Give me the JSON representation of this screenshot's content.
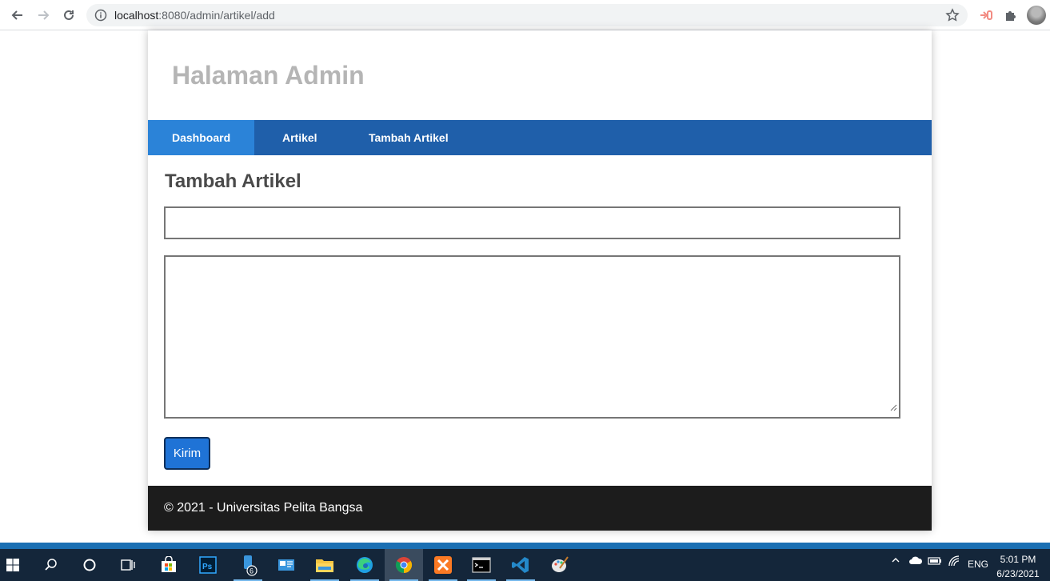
{
  "browser": {
    "url_host": "localhost",
    "url_path": ":8080/admin/artikel/add"
  },
  "header": {
    "title": "Halaman Admin"
  },
  "nav": {
    "items": [
      {
        "label": "Dashboard"
      },
      {
        "label": "Artikel"
      },
      {
        "label": "Tambah Artikel"
      }
    ]
  },
  "form": {
    "heading": "Tambah Artikel",
    "title_value": "",
    "body_value": "",
    "submit_label": "Kirim"
  },
  "footer": {
    "text": "© 2021 - Universitas Pelita Bangsa"
  },
  "taskbar": {
    "badge_count": "6",
    "lang": "ENG",
    "time": "5:01 PM",
    "date": "6/23/2021"
  },
  "colors": {
    "nav_bg": "#1f5faa",
    "nav_active": "#2b83d8",
    "button": "#1f73d6",
    "footer_bg": "#1c1c1c"
  }
}
